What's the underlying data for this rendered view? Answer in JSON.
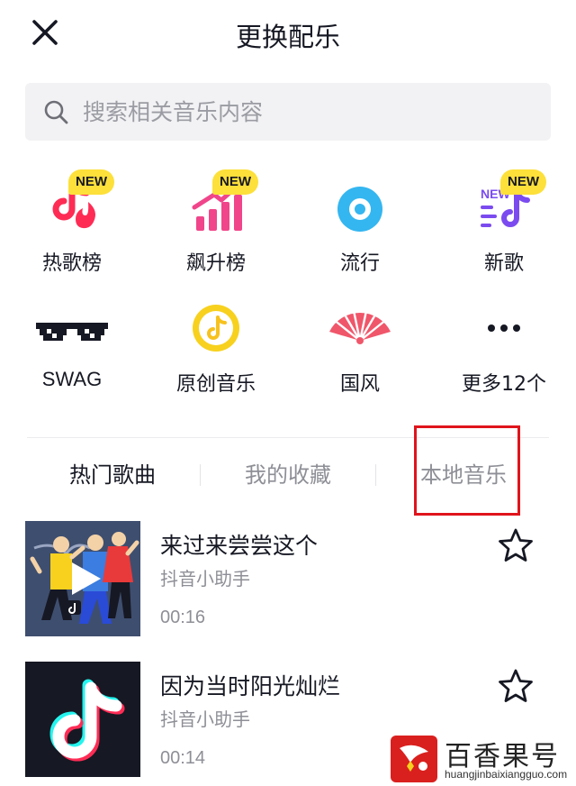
{
  "header": {
    "title": "更换配乐",
    "close_icon": "close-icon"
  },
  "search": {
    "placeholder": "搜索相关音乐内容",
    "icon": "search-icon"
  },
  "categories": [
    {
      "label": "热歌榜",
      "icon": "hot-chart-icon",
      "badge": "NEW"
    },
    {
      "label": "飙升榜",
      "icon": "rising-chart-icon",
      "badge": "NEW"
    },
    {
      "label": "流行",
      "icon": "disc-icon"
    },
    {
      "label": "新歌",
      "icon": "new-songs-icon",
      "badge": "NEW",
      "icon_text": "NEW"
    },
    {
      "label": "SWAG",
      "icon": "pixel-sunglasses-icon"
    },
    {
      "label": "原创音乐",
      "icon": "original-music-icon"
    },
    {
      "label": "国风",
      "icon": "folding-fan-icon"
    },
    {
      "label": "更多12个",
      "icon": "more-dots-icon"
    }
  ],
  "tabs": [
    {
      "label": "热门歌曲",
      "active": true
    },
    {
      "label": "我的收藏",
      "active": false
    },
    {
      "label": "本地音乐",
      "active": false
    }
  ],
  "songs": [
    {
      "title": "来过来尝尝这个",
      "artist": "抖音小助手",
      "duration": "00:16"
    },
    {
      "title": "因为当时阳光灿烂",
      "artist": "抖音小助手",
      "duration": "00:14"
    }
  ],
  "watermark": {
    "name": "百香果号",
    "url": "huangjinbaixiangguo.com"
  },
  "colors": {
    "accent_pink": "#fe2c55",
    "accent_cyan": "#25f4ee",
    "badge_yellow": "#fde03a",
    "highlight_red": "#e0141c",
    "text_primary": "#161823",
    "text_secondary": "#8e8f96"
  }
}
